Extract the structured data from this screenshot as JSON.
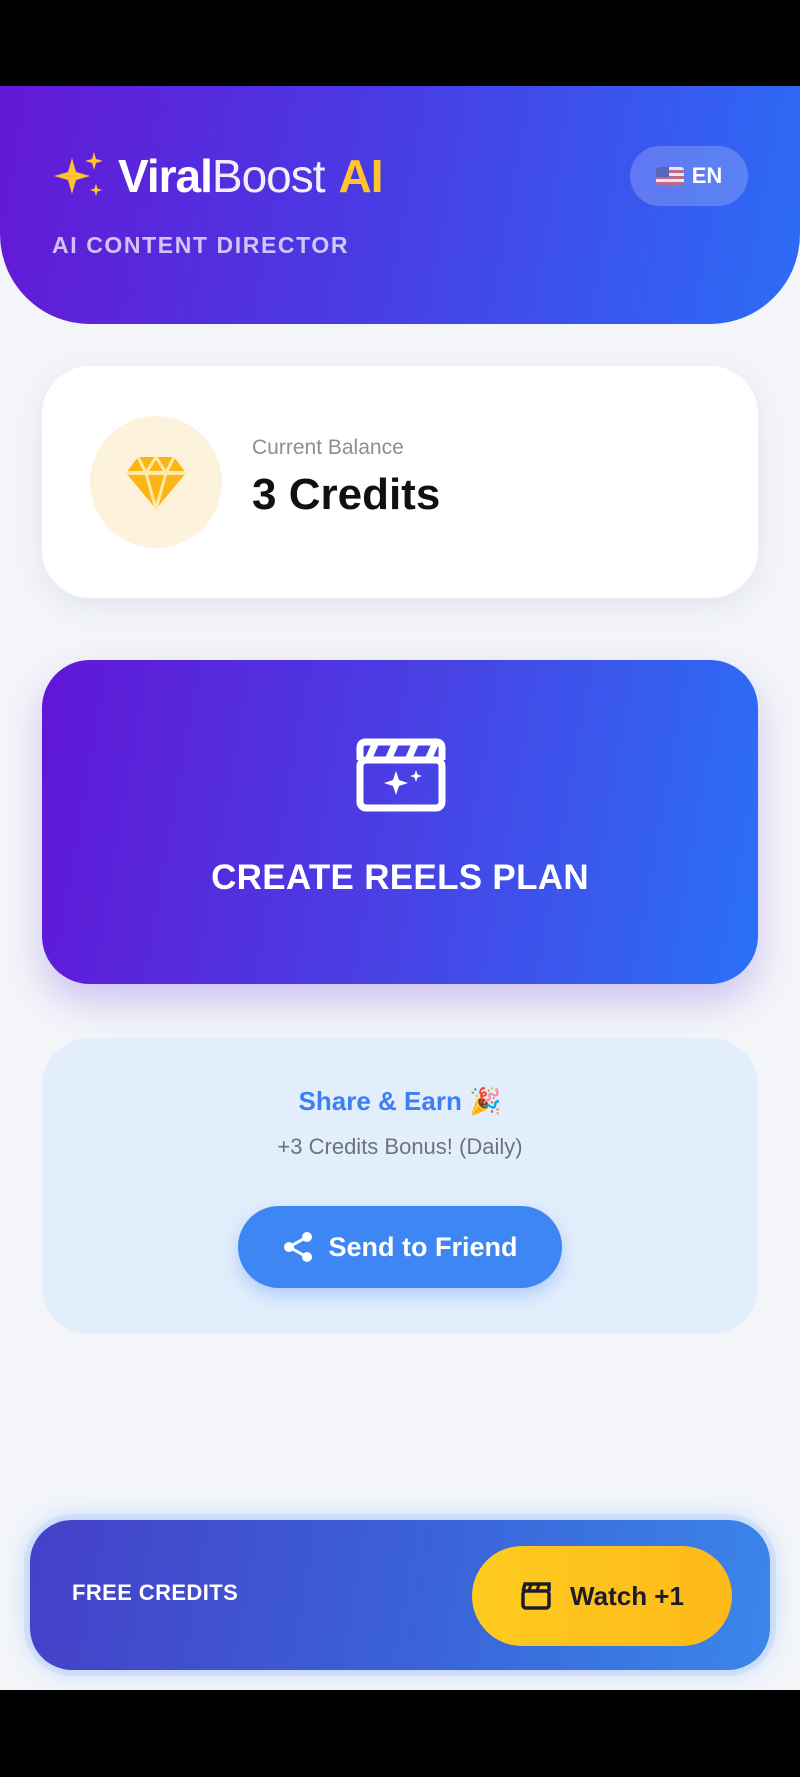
{
  "header": {
    "brand_part1": "Viral",
    "brand_part2": "Boost",
    "brand_part3": "AI",
    "subtitle": "AI CONTENT DIRECTOR",
    "language_label": "EN",
    "language_icon": "us-flag-icon"
  },
  "balance": {
    "label": "Current Balance",
    "value": "3 Credits",
    "icon": "gem-icon"
  },
  "create": {
    "label": "CREATE REELS PLAN",
    "icon": "clapperboard-icon"
  },
  "share": {
    "title": "Share & Earn 🎉",
    "subtitle": "+3 Credits Bonus! (Daily)",
    "button_label": "Send to Friend",
    "button_icon": "share-icon"
  },
  "free_credits": {
    "label": "FREE CREDITS",
    "button_label": "Watch +1",
    "button_icon": "video-icon"
  },
  "colors": {
    "gradient_start": "#6116d6",
    "gradient_end": "#2a70f8",
    "accent_yellow": "#ffc62c",
    "share_blue": "#3d86f3"
  }
}
